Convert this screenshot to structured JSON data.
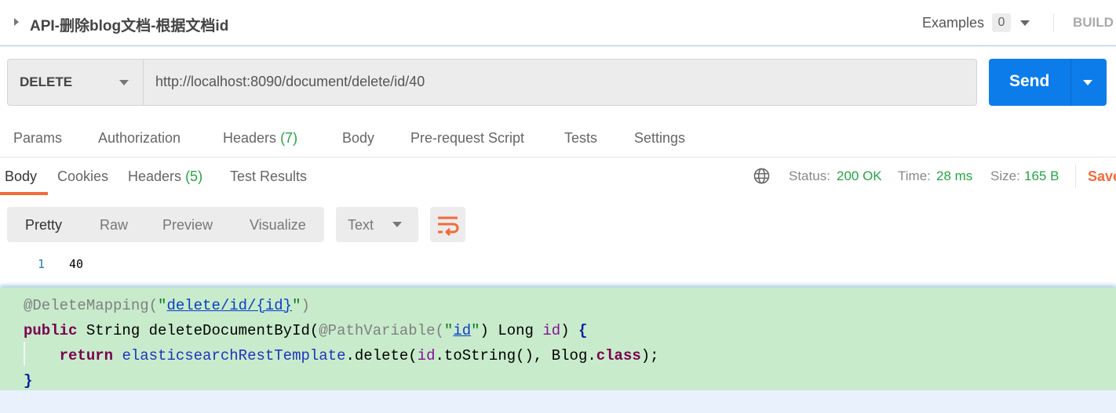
{
  "header": {
    "title": "API-删除blog文档-根据文档id",
    "examples_label": "Examples",
    "examples_count": "0",
    "build_label": "BUILD"
  },
  "request": {
    "method": "DELETE",
    "url": "http://localhost:8090/document/delete/id/40",
    "send_label": "Send"
  },
  "request_tabs": [
    {
      "label": "Params"
    },
    {
      "label": "Authorization"
    },
    {
      "label": "Headers",
      "count": "(7)"
    },
    {
      "label": "Body"
    },
    {
      "label": "Pre-request Script"
    },
    {
      "label": "Tests"
    },
    {
      "label": "Settings"
    }
  ],
  "response_tabs": [
    {
      "label": "Body",
      "active": true
    },
    {
      "label": "Cookies"
    },
    {
      "label": "Headers",
      "count": "(5)"
    },
    {
      "label": "Test Results"
    }
  ],
  "status": {
    "status_label": "Status:",
    "status_value": "200 OK",
    "time_label": "Time:",
    "time_value": "28 ms",
    "size_label": "Size:",
    "size_value": "165 B",
    "save_label": "Save"
  },
  "view_modes": [
    "Pretty",
    "Raw",
    "Preview",
    "Visualize"
  ],
  "format": "Text",
  "response_body": {
    "line_number": "1",
    "value": "40"
  },
  "colors": {
    "accent": "#f26b3a",
    "send": "#0c7ceb",
    "success": "#26a544",
    "code_bg": "#c8ebcc"
  },
  "code": [
    [
      [
        "ann",
        "@DeleteMapping("
      ],
      [
        "str",
        "\""
      ],
      [
        "lnk",
        "delete/id/{id}"
      ],
      [
        "str",
        "\""
      ],
      [
        "ann",
        ")"
      ]
    ],
    [
      [
        "kwp",
        "public"
      ],
      [
        "pl",
        " String deleteDocumentById("
      ],
      [
        "ann",
        "@PathVariable("
      ],
      [
        "str",
        "\""
      ],
      [
        "lnk",
        "id"
      ],
      [
        "str",
        "\""
      ],
      [
        "pl",
        ") Long "
      ],
      [
        "par",
        "id"
      ],
      [
        "pl",
        ") "
      ],
      [
        "brc",
        "{"
      ]
    ],
    [
      [
        "pl",
        "    "
      ],
      [
        "kwr",
        "return"
      ],
      [
        "pl",
        " "
      ],
      [
        "fld",
        "elasticsearchRestTemplate"
      ],
      [
        "pl",
        ".delete("
      ],
      [
        "par",
        "id"
      ],
      [
        "pl",
        ".toString(), Blog."
      ],
      [
        "kwr",
        "class"
      ],
      [
        "pl",
        ");"
      ]
    ],
    [
      [
        "brc",
        "}"
      ]
    ]
  ]
}
